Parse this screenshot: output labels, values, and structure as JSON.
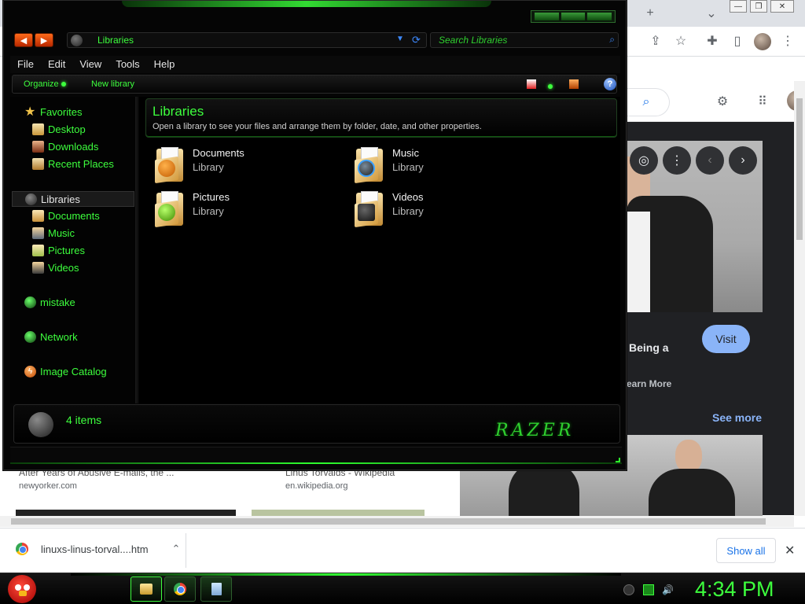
{
  "browser": {
    "new_tab_symbol": "+",
    "tab_menu_symbol": "⌄",
    "window_buttons": [
      "—",
      "❐",
      "✕"
    ],
    "toolbar_icons": [
      "share-icon",
      "star-icon",
      "extensions-icon",
      "sidepanel-icon",
      "profile-avatar",
      "menu-icon"
    ],
    "google": {
      "visit_label": "Visit",
      "result_title_fragment": "Being a",
      "learn_more": "earn More",
      "see_more": "See more",
      "nav_prev": "‹",
      "nav_next": "›",
      "more_dots": "⋮"
    },
    "results": [
      {
        "title": "After Years of Abusive E-mails, the ...",
        "site": "newyorker.com"
      },
      {
        "title": "Linus Torvalds - Wikipedia",
        "site": "en.wikipedia.org"
      }
    ],
    "download": {
      "filename": "linuxs-linus-torval....htm",
      "chevron": "⌃",
      "show_all": "Show all",
      "close": "✕"
    }
  },
  "explorer": {
    "address": "Libraries",
    "search_placeholder": "Search Libraries",
    "menu": [
      "File",
      "Edit",
      "View",
      "Tools",
      "Help"
    ],
    "commands": {
      "organize": "Organize",
      "new_library": "New library"
    },
    "nav": {
      "favorites": "Favorites",
      "favorites_items": [
        "Desktop",
        "Downloads",
        "Recent Places"
      ],
      "libraries": "Libraries",
      "libraries_items": [
        "Documents",
        "Music",
        "Pictures",
        "Videos"
      ],
      "mistake": "mistake",
      "network": "Network",
      "image_catalog": "Image Catalog"
    },
    "header": {
      "title": "Libraries",
      "subtitle": "Open a library to see your files and arrange them by folder, date, and other properties."
    },
    "libraries": [
      {
        "name": "Documents",
        "type": "Library"
      },
      {
        "name": "Music",
        "type": "Library"
      },
      {
        "name": "Pictures",
        "type": "Library"
      },
      {
        "name": "Videos",
        "type": "Library"
      }
    ],
    "status": {
      "items": "4 items"
    },
    "brand": "RAZER"
  },
  "taskbar": {
    "clock": "4:34 PM"
  },
  "colors": {
    "accent_green": "#3dff3d",
    "google_blue": "#8ab4f8",
    "explorer_bg": "#050505"
  }
}
